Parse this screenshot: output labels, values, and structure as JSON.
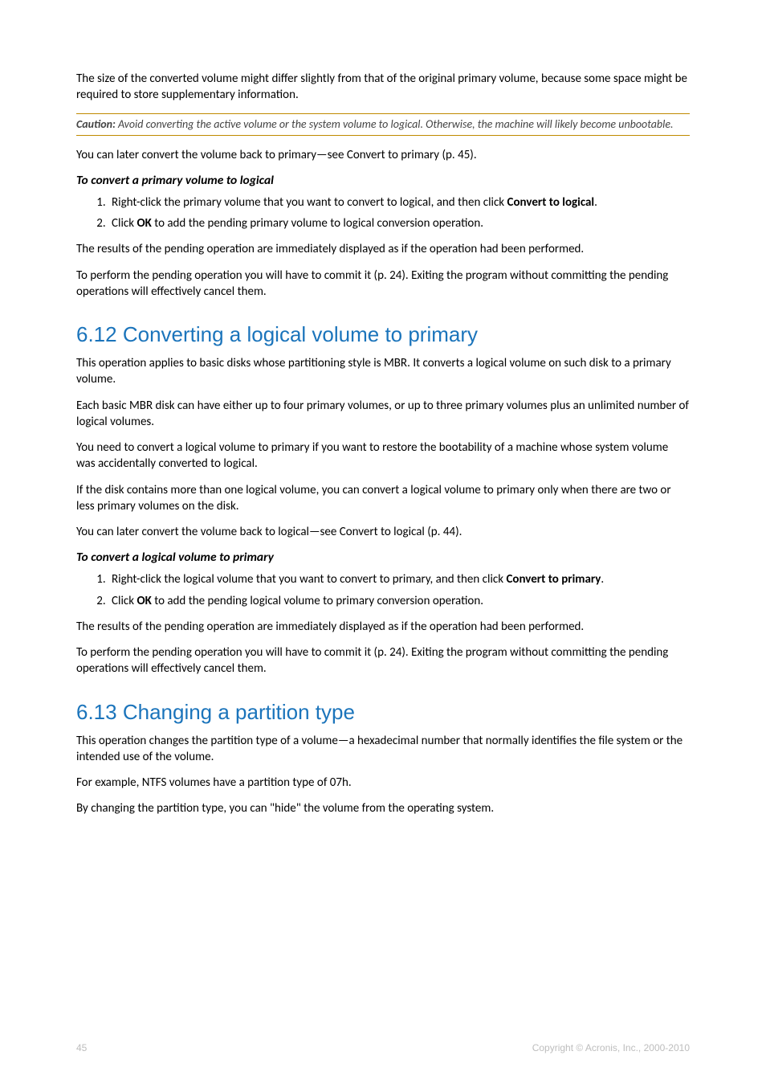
{
  "intro": {
    "p1": "The size of the converted volume might differ slightly from that of the original primary volume, because some space might be required to store supplementary information."
  },
  "caution": {
    "label": "Caution:",
    "text": " Avoid converting the active volume or the system volume to logical. Otherwise, the machine will likely become unbootable."
  },
  "p_after_caution": "You can later convert the volume back to primary—see Convert to primary (p. 45).",
  "section_a": {
    "subhead": "To convert a primary volume to logical",
    "step1_pre": "Right-click the primary volume that you want to convert to logical, and then click ",
    "step1_bold": "Convert to logical",
    "step1_post": ".",
    "step2_pre": "Click ",
    "step2_bold": "OK",
    "step2_post": " to add the pending primary volume to logical conversion operation.",
    "para1": "The results of the pending operation are immediately displayed as if the operation had been performed.",
    "para2": "To perform the pending operation you will have to commit it (p. 24). Exiting the program without committing the pending operations will effectively cancel them."
  },
  "section_612": {
    "title": "6.12 Converting a logical volume to primary",
    "p1": "This operation applies to basic disks whose partitioning style is MBR. It converts a logical volume on such disk to a primary volume.",
    "p2": "Each basic MBR disk can have either up to four primary volumes, or up to three primary volumes plus an unlimited number of logical volumes.",
    "p3": "You need to convert a logical volume to primary if you want to restore the bootability of a machine whose system volume was accidentally converted to logical.",
    "p4": "If the disk contains more than one logical volume, you can convert a logical volume to primary only when there are two or less primary volumes on the disk.",
    "p5": "You can later convert the volume back to logical—see Convert to logical (p. 44).",
    "subhead": "To convert a logical volume to primary",
    "step1_pre": "Right-click the logical volume that you want to convert to primary, and then click ",
    "step1_bold": "Convert to primary",
    "step1_post": ".",
    "step2_pre": "Click ",
    "step2_bold": "OK",
    "step2_post": " to add the pending logical volume to primary conversion operation.",
    "para1": "The results of the pending operation are immediately displayed as if the operation had been performed.",
    "para2": "To perform the pending operation you will have to commit it (p. 24). Exiting the program without committing the pending operations will effectively cancel them."
  },
  "section_613": {
    "title": "6.13 Changing a partition type",
    "p1": "This operation changes the partition type of a volume—a hexadecimal number that normally identifies the file system or the intended use of the volume.",
    "p2": "For example, NTFS volumes have a partition type of 07h.",
    "p3": "By changing the partition type, you can \"hide\" the volume from the operating system."
  },
  "footer": {
    "page": "45",
    "copyright": "Copyright © Acronis, Inc., 2000-2010"
  }
}
